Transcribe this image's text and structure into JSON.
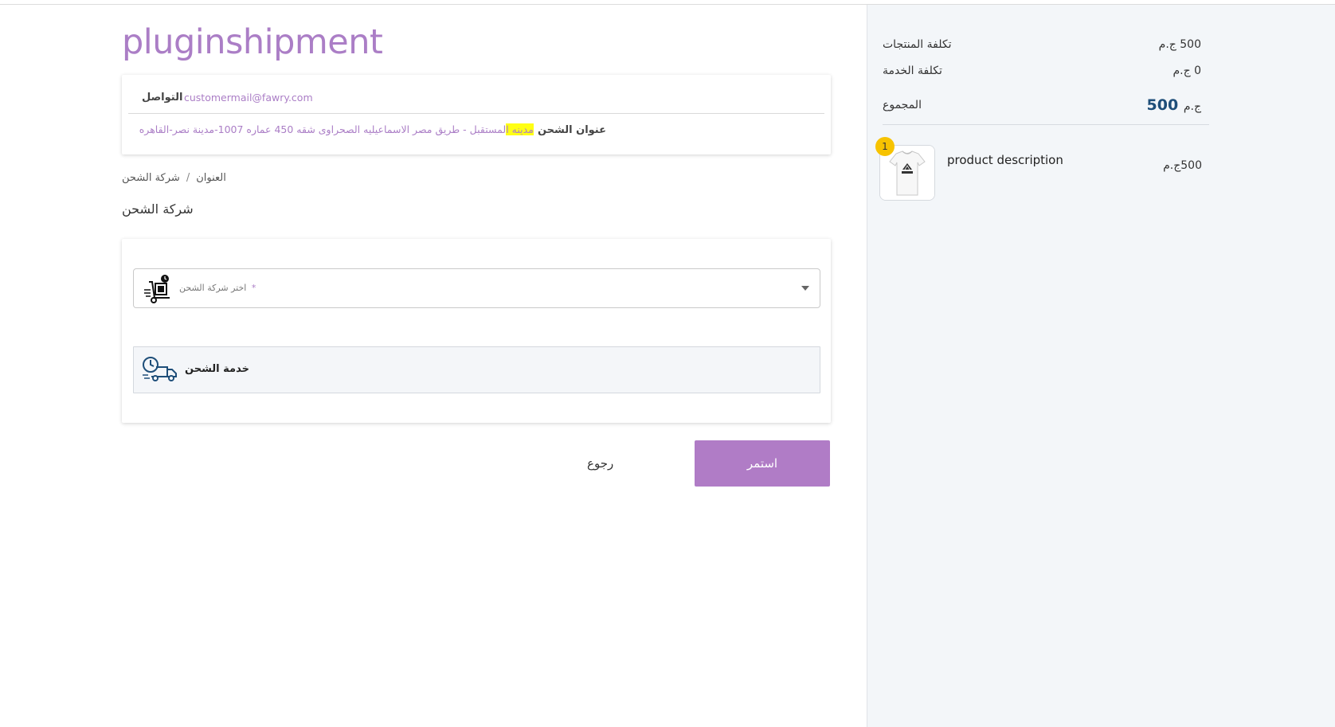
{
  "brand": {
    "name": "pluginshipment"
  },
  "contact": {
    "label": "التواصل",
    "email": "customermail@fawry.com"
  },
  "address": {
    "label": "عنوان الشحن",
    "highlight": "مدينه ا",
    "value_rest": "لمستقبل - طريق مصر الاسماعيليه الصحراوى شقه 450 عماره 1007-مدينة نصر-القاهره"
  },
  "breadcrumb": {
    "items": [
      "العنوان",
      "شركة الشحن"
    ],
    "separator": "/"
  },
  "section": {
    "title": "شركة الشحن"
  },
  "shipping_select": {
    "placeholder": "اختر شركة الشحن",
    "required_mark": "*"
  },
  "service": {
    "label": "خدمة الشحن"
  },
  "actions": {
    "continue": "استمر",
    "back": "رجوع"
  },
  "summary": {
    "products_cost_label": "تكلفة المنتجات",
    "products_cost_value": "500 ج.م",
    "service_cost_label": "تكلفة الخدمة",
    "service_cost_value": "0 ج.م",
    "total_label": "المجموع",
    "total_amount": "500",
    "total_currency": "ج.م"
  },
  "cart": {
    "items": [
      {
        "quantity": "1",
        "description": "product description",
        "price": "500ج.م",
        "image_icon": "tshirt-icon"
      }
    ]
  },
  "colors": {
    "accent": "#ab7ec6",
    "button": "#b07cc6",
    "total": "#1e4e79",
    "badge": "#f7c300",
    "highlight": "#ffff14"
  }
}
